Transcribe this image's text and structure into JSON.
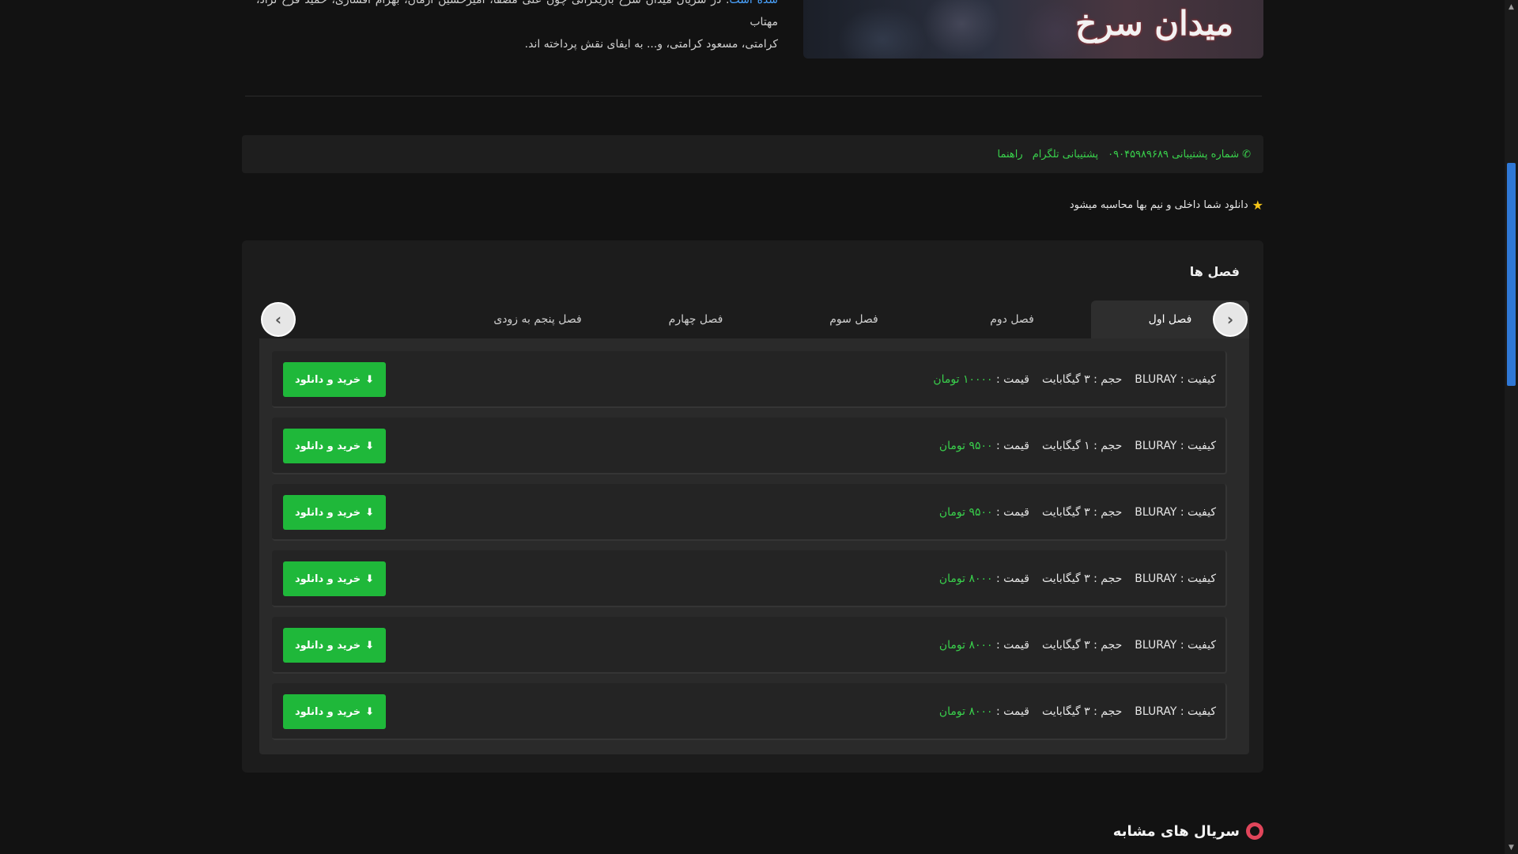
{
  "hero": {
    "poster_title": "میدان سرخ",
    "synopsis_link": "شده است",
    "synopsis_line1": ". در سریال میدان سرخ بازیگرانی چون علی مصفا، امیرحسین آرمان، بهرام افشاری، حمید فرخ نژاد، مهتاب",
    "synopsis_line2": "کرامتی، مسعود کرامتی، و... به ایفای نقش پرداخته اند."
  },
  "support": {
    "phone_label": "شماره پشتیبانی ۰۹۰۴۵۹۸۹۶۸۹",
    "telegram_label": "پشتیبانی تلگرام",
    "guide_label": "راهنما"
  },
  "note": {
    "text": "دانلود شما داخلی و نیم بها محاسبه میشود"
  },
  "seasons": {
    "title": "فصل ها",
    "tabs": [
      {
        "label": "فصل اول"
      },
      {
        "label": "فصل دوم"
      },
      {
        "label": "فصل سوم"
      },
      {
        "label": "فصل چهارم"
      },
      {
        "label": "فصل پنجم به زودی"
      }
    ],
    "prev_icon": "‹",
    "next_icon": "›",
    "rows": [
      {
        "quality": "کیفیت : BLURAY",
        "size": "حجم : ۳ گیگابایت",
        "price_label": "قیمت :",
        "price": "۱۰۰۰۰ تومان"
      },
      {
        "quality": "کیفیت : BLURAY",
        "size": "حجم : ۱ گیگابایت",
        "price_label": "قیمت :",
        "price": "۹۵۰۰ تومان"
      },
      {
        "quality": "کیفیت : BLURAY",
        "size": "حجم : ۳ گیگابایت",
        "price_label": "قیمت :",
        "price": "۹۵۰۰ تومان"
      },
      {
        "quality": "کیفیت : BLURAY",
        "size": "حجم : ۳ گیگابایت",
        "price_label": "قیمت :",
        "price": "۸۰۰۰ تومان"
      },
      {
        "quality": "کیفیت : BLURAY",
        "size": "حجم : ۳ گیگابایت",
        "price_label": "قیمت :",
        "price": "۸۰۰۰ تومان"
      },
      {
        "quality": "کیفیت : BLURAY",
        "size": "حجم : ۳ گیگابایت",
        "price_label": "قیمت :",
        "price": "۸۰۰۰ تومان"
      }
    ],
    "button_label": "خرید و دانلود"
  },
  "similar": {
    "title": "سریال های مشابه"
  },
  "colors": {
    "accent_green": "#1fb83a",
    "price_green": "#39d14c",
    "scroll_thumb": "#2f78d6"
  }
}
